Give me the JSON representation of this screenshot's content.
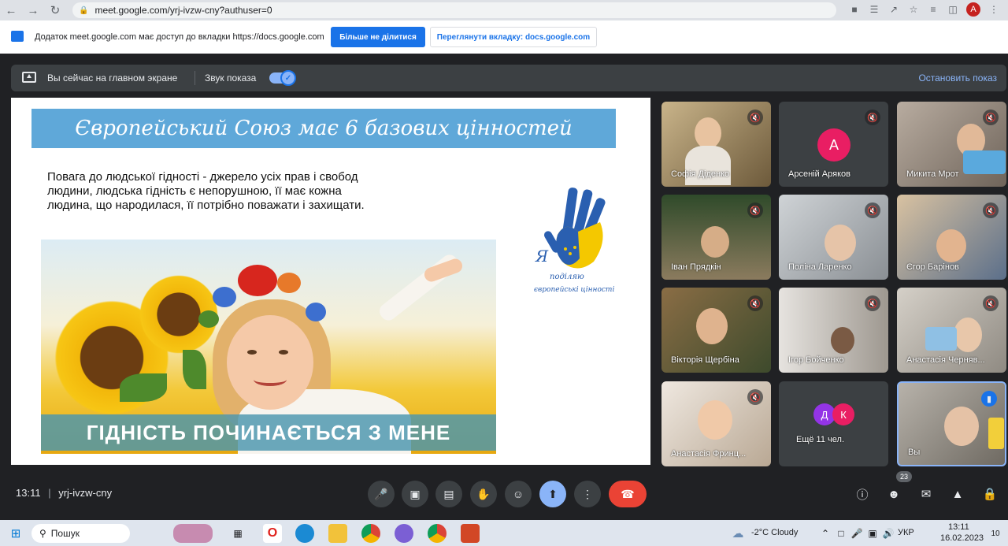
{
  "browser": {
    "url": "meet.google.com/yrj-ivzw-cny?authuser=0",
    "profile_initial": "A"
  },
  "share_bar": {
    "message": "Додаток meet.google.com має доступ до вкладки https://docs.google.com",
    "stop_label": "Більше не ділитися",
    "view_label": "Переглянути вкладку: docs.google.com"
  },
  "presentation_bar": {
    "status": "Вы сейчас на главном экране",
    "sound_label": "Звук показа",
    "stop_label": "Остановить показ"
  },
  "slide": {
    "title": "Європейський Союз має 6 базових цінностей",
    "body": "Повага до людської гідності - джерело усіх прав і свобод людини, людська гідність є непорушною, її має кожна людина, що народилася, її потрібно поважати і захищати.",
    "photo_caption": "ГІДНІСТЬ ПОЧИНАЄТЬСЯ З МЕНЕ",
    "logo_text_1": "Я",
    "logo_text_2": "поділяю",
    "logo_text_3": "європейські цінності"
  },
  "participants": [
    {
      "name": "Софія Діденко"
    },
    {
      "name": "Арсеній Аряков",
      "initial": "А"
    },
    {
      "name": "Микита Мрот"
    },
    {
      "name": "Іван Прядкін"
    },
    {
      "name": "Поліна Ларенко"
    },
    {
      "name": "Єгор Барінов"
    },
    {
      "name": "Вікторія Щербіна"
    },
    {
      "name": "Ігор Бойченко"
    },
    {
      "name": "Анастасія Черняв..."
    },
    {
      "name": "Анастасія Фринц..."
    },
    {
      "name": "Ещё 11 чел.",
      "initial_1": "Д",
      "initial_2": "К"
    },
    {
      "name": "Вы"
    }
  ],
  "controls": {
    "time": "13:11",
    "meeting_code": "yrj-ivzw-cny",
    "people_count": "23"
  },
  "taskbar": {
    "search_label": "Пошук",
    "weather": "-2°C  Cloudy",
    "language": "УКР",
    "time": "13:11",
    "date": "16.02.2023",
    "notifications": "10"
  },
  "colors": {
    "meet_bg": "#202124",
    "accent": "#8ab4f8",
    "share_button": "#1a73e8",
    "hangup": "#ea4335",
    "slide_title_bg": "#5fa8d9"
  }
}
